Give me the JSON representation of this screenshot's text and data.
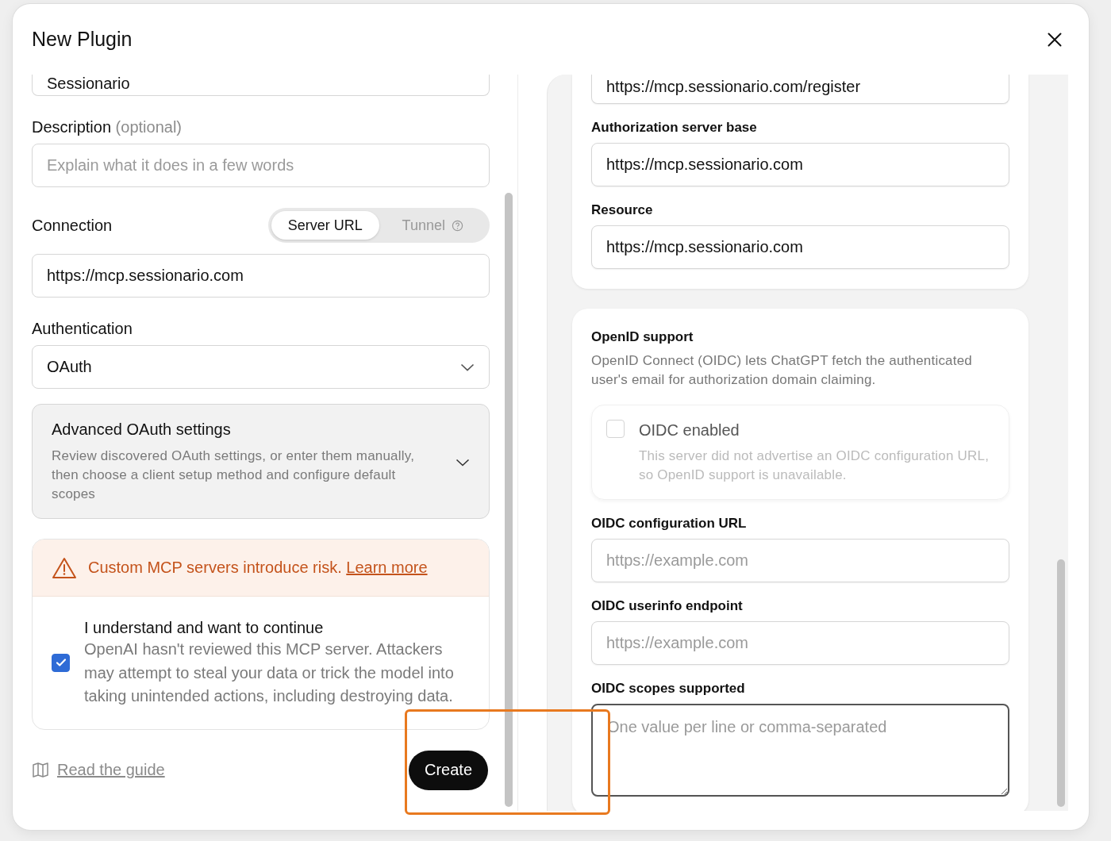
{
  "window": {
    "title": "New Plugin"
  },
  "left": {
    "name_field": {
      "value": "Sessionario"
    },
    "description": {
      "label": "Description",
      "hint": "(optional)",
      "placeholder": "Explain what it does in a few words"
    },
    "connection": {
      "label": "Connection",
      "options": [
        {
          "label": "Server URL",
          "selected": true
        },
        {
          "label": "Tunnel",
          "selected": false
        }
      ],
      "value": "https://mcp.sessionario.com"
    },
    "authentication": {
      "label": "Authentication",
      "value": "OAuth"
    },
    "advanced": {
      "title": "Advanced OAuth settings",
      "text": "Review discovered OAuth settings, or enter them manually, then choose a client setup method and configure default scopes",
      "expanded": false
    },
    "warning": {
      "text": "Custom MCP servers introduce risk.",
      "link": "Learn more"
    },
    "consent": {
      "title": "I understand and want to continue",
      "text": "OpenAI hasn't reviewed this MCP server. Attackers may attempt to steal your data or trick the model into taking unintended actions, including destroying data.",
      "checked": true
    },
    "footer": {
      "guide_link": "Read the guide",
      "create_button": "Create"
    }
  },
  "right": {
    "oauth_fields": [
      {
        "value": "https://mcp.sessionario.com/register"
      },
      {
        "label": "Authorization server base",
        "value": "https://mcp.sessionario.com"
      },
      {
        "label": "Resource",
        "value": "https://mcp.sessionario.com"
      }
    ],
    "openid": {
      "title": "OpenID support",
      "text": "OpenID Connect (OIDC) lets ChatGPT fetch the authenticated user's email for authorization domain claiming.",
      "oidc_toggle": {
        "label": "OIDC enabled",
        "text": "This server did not advertise an OIDC configuration URL, so OpenID support is unavailable.",
        "checked": false,
        "disabled": true
      },
      "fields": [
        {
          "kind": "input",
          "label": "OIDC configuration URL",
          "placeholder": "https://example.com",
          "focused": false
        },
        {
          "kind": "input",
          "label": "OIDC userinfo endpoint",
          "placeholder": "https://example.com",
          "focused": false
        },
        {
          "kind": "textarea",
          "label": "OIDC scopes supported",
          "placeholder": "One value per line or comma-separated",
          "focused": true
        }
      ]
    }
  }
}
